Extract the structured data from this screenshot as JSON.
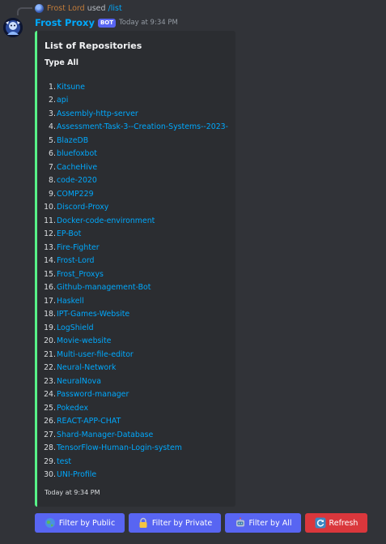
{
  "reply": {
    "user": "Frost Lord",
    "used_text": "used",
    "command": "/list"
  },
  "message": {
    "author": "Frost Proxy",
    "badge": "BOT",
    "timestamp": "Today at 9:34 PM"
  },
  "embed": {
    "accent_color": "#57f287",
    "title": "List of Repositories",
    "subtitle": "Type All",
    "repositories": [
      {
        "num": "1.",
        "name": "Kitsune"
      },
      {
        "num": "2.",
        "name": "api"
      },
      {
        "num": "3.",
        "name": "Assembly-http-server"
      },
      {
        "num": "4.",
        "name": "Assessment-Task-3--Creation-Systems--2023-"
      },
      {
        "num": "5.",
        "name": "BlazeDB"
      },
      {
        "num": "6.",
        "name": "bluefoxbot"
      },
      {
        "num": "7.",
        "name": "CacheHive"
      },
      {
        "num": "8.",
        "name": "code-2020"
      },
      {
        "num": "9.",
        "name": "COMP229"
      },
      {
        "num": "10.",
        "name": "Discord-Proxy"
      },
      {
        "num": "11.",
        "name": "Docker-code-environment"
      },
      {
        "num": "12.",
        "name": "EP-Bot"
      },
      {
        "num": "13.",
        "name": "Fire-Fighter"
      },
      {
        "num": "14.",
        "name": "Frost-Lord"
      },
      {
        "num": "15.",
        "name": "Frost_Proxys"
      },
      {
        "num": "16.",
        "name": "Github-management-Bot"
      },
      {
        "num": "17.",
        "name": "Haskell"
      },
      {
        "num": "18.",
        "name": "IPT-Games-Website"
      },
      {
        "num": "19.",
        "name": "LogShield"
      },
      {
        "num": "20.",
        "name": "Movie-website"
      },
      {
        "num": "21.",
        "name": "Multi-user-file-editor"
      },
      {
        "num": "22.",
        "name": "Neural-Network"
      },
      {
        "num": "23.",
        "name": "NeuralNova"
      },
      {
        "num": "24.",
        "name": "Password-manager"
      },
      {
        "num": "25.",
        "name": "Pokedex"
      },
      {
        "num": "26.",
        "name": "REACT-APP-CHAT"
      },
      {
        "num": "27.",
        "name": "Shard-Manager-Database"
      },
      {
        "num": "28.",
        "name": "TensorFlow-Human-Login-system"
      },
      {
        "num": "29.",
        "name": "test"
      },
      {
        "num": "30.",
        "name": "UNI-Profile"
      }
    ],
    "footer": "Today at 9:34 PM"
  },
  "buttons": {
    "public": {
      "label": "Filter by Public",
      "icon": "globe-icon"
    },
    "private": {
      "label": "Filter by Private",
      "icon": "lock-icon"
    },
    "all": {
      "label": "Filter by All",
      "icon": "robot-icon"
    },
    "refresh": {
      "label": "Refresh",
      "icon": "refresh-icon"
    }
  },
  "colors": {
    "background": "#313338",
    "embed_background": "#2b2d31",
    "link": "#00a8fc",
    "blurple": "#5865f2",
    "danger": "#da373c"
  }
}
